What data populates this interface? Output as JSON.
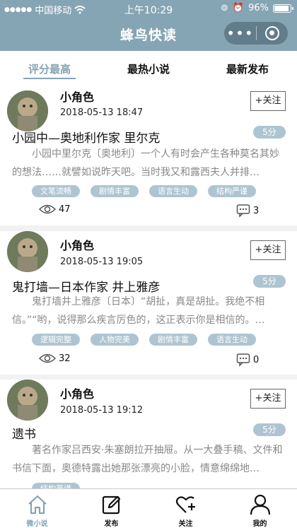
{
  "status_bar": {
    "carrier": "中国移动",
    "time": "上午10:29",
    "battery": "96%",
    "battery_level": 0.96
  },
  "nav": {
    "title": "蜂鸟快读",
    "more_icon": "more-dots-icon",
    "close_icon": "target-circle-icon"
  },
  "tabs": [
    {
      "label": "评分最高",
      "active": true
    },
    {
      "label": "最热小说",
      "active": false
    },
    {
      "label": "最新发布",
      "active": false
    }
  ],
  "posts": [
    {
      "author": "小角色",
      "date": "2018-05-13 18:47",
      "follow_label": "+关注",
      "title": "小园中—奥地利作家 里尔克",
      "score": "5分",
      "excerpt": "小园中里尔克〔奥地利〕一个人有时会产生各种莫名其妙的想法……就譬如说昨天吧。当时我又和露西夫人并排…",
      "tags": [
        "文笔流畅",
        "剧情丰富",
        "语言生动",
        "结构严谨"
      ],
      "views": "47",
      "comments": "3"
    },
    {
      "author": "小角色",
      "date": "2018-05-13 19:05",
      "follow_label": "+关注",
      "title": "鬼打墙—日本作家 井上雅彦",
      "score": "5分",
      "excerpt": "鬼打墙井上雅彦〔日本〕“胡扯，真是胡扯。我绝不相信。”“哟，说得那么疾言厉色的，这正表示你是相信的。…",
      "tags": [
        "逻辑完整",
        "人物完美",
        "剧情丰富",
        "语言生动"
      ],
      "views": "32",
      "comments": "0"
    },
    {
      "author": "小角色",
      "date": "2018-05-13 19:12",
      "follow_label": "+关注",
      "title": "遗书",
      "score": "5分",
      "excerpt": "著名作家吕西安·朱塞朗拉开抽屉。从一大叠手稿、文件和书信下面，奥德特露出她那张漂亮的小脸，情意绵绵地…",
      "tags": [
        "结构严谨"
      ],
      "views": "",
      "comments": ""
    }
  ],
  "tabbar": [
    {
      "label": "微小说",
      "icon": "home-icon",
      "active": true
    },
    {
      "label": "发布",
      "icon": "edit-icon",
      "active": false
    },
    {
      "label": "关注",
      "icon": "heart-plus-icon",
      "active": false
    },
    {
      "label": "我的",
      "icon": "user-icon",
      "active": false
    }
  ],
  "colors": {
    "brand": "#86a5b4",
    "tag_bg": "#aec5d1",
    "excerpt_text": "#888888"
  }
}
